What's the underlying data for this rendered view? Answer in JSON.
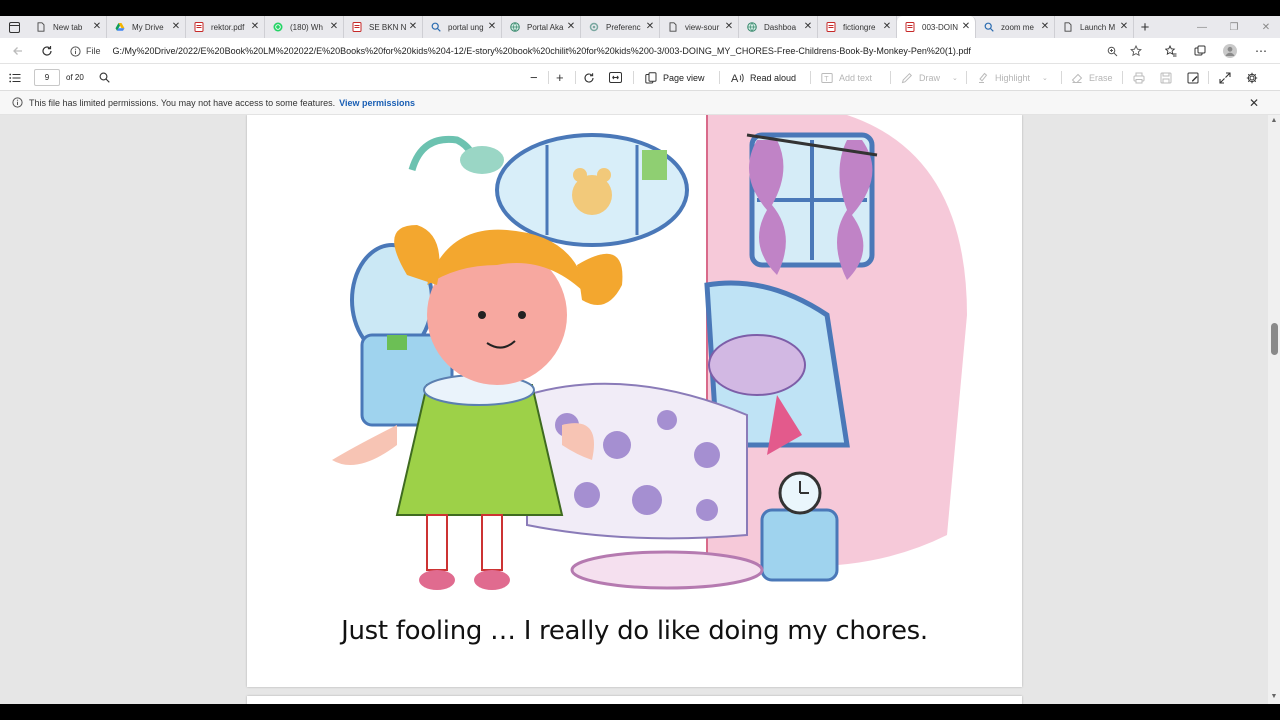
{
  "tabs": [
    {
      "label": "New tab",
      "icon": "page-icon",
      "active": false
    },
    {
      "label": "My Drive",
      "icon": "drive-icon",
      "active": false
    },
    {
      "label": "rektor.pdf",
      "icon": "pdf-icon",
      "active": false
    },
    {
      "label": "(180) Wh",
      "icon": "whatsapp-icon",
      "active": false
    },
    {
      "label": "SE BKN N",
      "icon": "pdf-icon",
      "active": false
    },
    {
      "label": "portal ung",
      "icon": "search-icon",
      "active": false
    },
    {
      "label": "Portal Aka",
      "icon": "globe-icon",
      "active": false
    },
    {
      "label": "Preferenc",
      "icon": "gear-icon",
      "active": false
    },
    {
      "label": "view-sour",
      "icon": "page-icon",
      "active": false
    },
    {
      "label": "Dashboa",
      "icon": "globe-icon",
      "active": false
    },
    {
      "label": "fictiongre",
      "icon": "pdf-icon",
      "active": false
    },
    {
      "label": "003-DOIN",
      "icon": "pdf-icon",
      "active": true
    },
    {
      "label": "zoom me",
      "icon": "search-icon",
      "active": false
    },
    {
      "label": "Launch M",
      "icon": "page-icon",
      "active": false
    }
  ],
  "address": {
    "scheme_label": "File",
    "url": "G:/My%20Drive/2022/E%20Book%20LM%202022/E%20Books%20for%20kids%204-12/E-story%20book%20chilit%20for%20kids%200-3/003-DOING_MY_CHORES-Free-Childrens-Book-By-Monkey-Pen%20(1).pdf"
  },
  "pdf_toolbar": {
    "page_number": "9",
    "page_total": "of 20",
    "page_view": "Page view",
    "read_aloud": "Read aloud",
    "add_text": "Add text",
    "draw": "Draw",
    "highlight": "Highlight",
    "erase": "Erase"
  },
  "permissions": {
    "message": "This file has limited permissions. You may not have access to some features.",
    "link": "View permissions"
  },
  "page": {
    "caption": "Just fooling … I really do like doing my chores."
  },
  "colors": {
    "link": "#1a5fb4",
    "pdf_red": "#c62828",
    "accent_blue": "#2b6cb0"
  }
}
